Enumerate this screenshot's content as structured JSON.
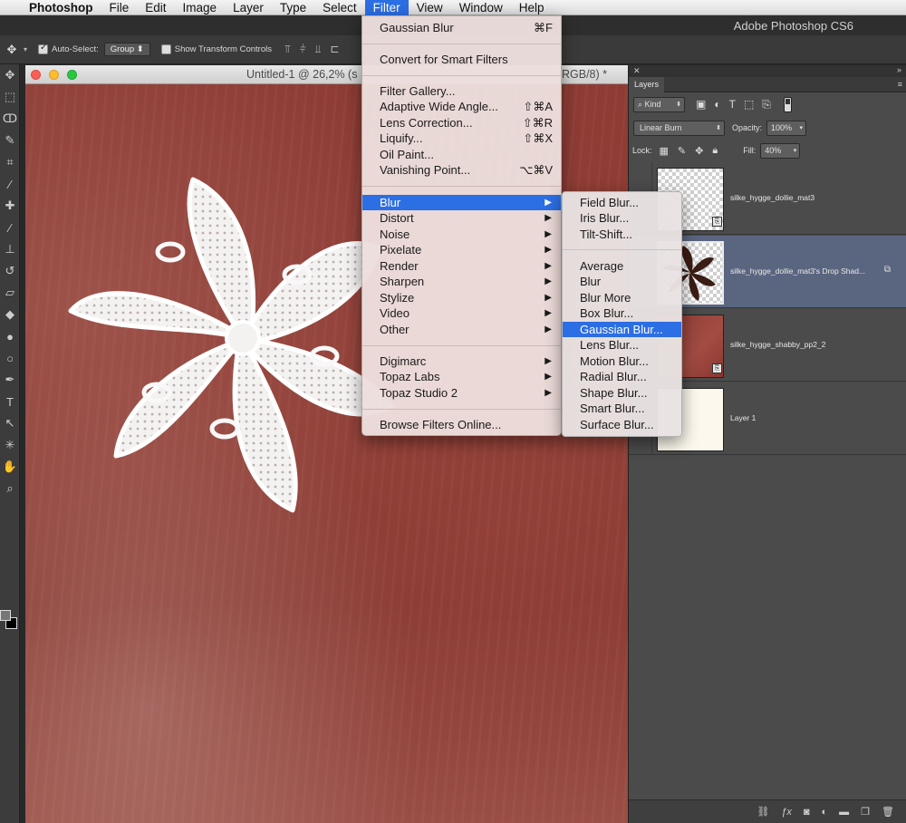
{
  "menubar": {
    "apple": "",
    "app": "Photoshop",
    "items": [
      "File",
      "Edit",
      "Image",
      "Layer",
      "Type",
      "Select",
      "Filter",
      "View",
      "Window",
      "Help"
    ],
    "active": "Filter"
  },
  "app_title": "Adobe Photoshop CS6",
  "options_bar": {
    "auto_select_label": "Auto-Select:",
    "auto_select_checked": true,
    "group_value": "Group",
    "show_transform_label": "Show Transform Controls",
    "show_transform_checked": false
  },
  "document": {
    "title": "Untitled-1 @ 26,2% (s",
    "title_tail": "RGB/8) *"
  },
  "filter_menu": {
    "last_filter": {
      "label": "Gaussian Blur",
      "shortcut": "⌘F"
    },
    "smart": "Convert for Smart Filters",
    "group1": [
      {
        "label": "Filter Gallery...",
        "shortcut": ""
      },
      {
        "label": "Adaptive Wide Angle...",
        "shortcut": "⇧⌘A"
      },
      {
        "label": "Lens Correction...",
        "shortcut": "⇧⌘R"
      },
      {
        "label": "Liquify...",
        "shortcut": "⇧⌘X"
      },
      {
        "label": "Oil Paint...",
        "shortcut": ""
      },
      {
        "label": "Vanishing Point...",
        "shortcut": "⌥⌘V"
      }
    ],
    "group2": [
      "Blur",
      "Distort",
      "Noise",
      "Pixelate",
      "Render",
      "Sharpen",
      "Stylize",
      "Video",
      "Other"
    ],
    "highlighted": "Blur",
    "group3": [
      "Digimarc",
      "Topaz Labs",
      "Topaz Studio 2"
    ],
    "browse": "Browse Filters Online..."
  },
  "blur_submenu": {
    "group1": [
      "Field Blur...",
      "Iris Blur...",
      "Tilt-Shift..."
    ],
    "group2": [
      "Average",
      "Blur",
      "Blur More",
      "Box Blur...",
      "Gaussian Blur...",
      "Lens Blur...",
      "Motion Blur...",
      "Radial Blur...",
      "Shape Blur...",
      "Smart Blur...",
      "Surface Blur..."
    ],
    "highlighted": "Gaussian Blur..."
  },
  "layers_panel": {
    "tab": "Layers",
    "kind": "Kind",
    "blend_mode": "Linear Burn",
    "opacity_label": "Opacity:",
    "opacity": "100%",
    "lock_label": "Lock:",
    "fill_label": "Fill:",
    "fill": "40%",
    "layers": [
      {
        "name": "silke_hygge_dollie_mat3",
        "selected": false
      },
      {
        "name": "silke_hygge_dollie_mat3's Drop Shad...",
        "selected": true
      },
      {
        "name": "silke_hygge_shabby_pp2_2",
        "selected": false
      },
      {
        "name": "Layer 1",
        "selected": false
      }
    ]
  },
  "colors": {
    "menu_highlight": "#2c6ee3",
    "canvas_red": "#8b3a33",
    "selected_layer": "#5a6680"
  }
}
